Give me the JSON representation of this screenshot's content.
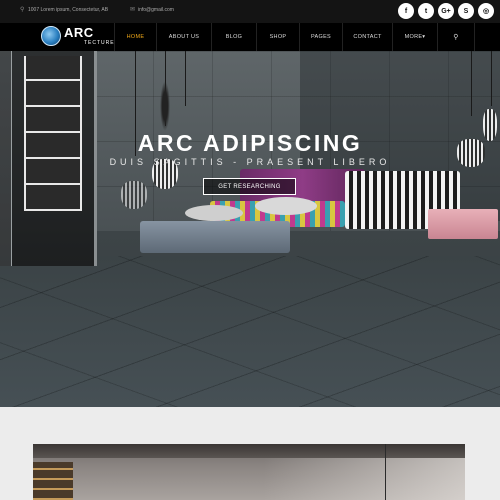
{
  "topbar": {
    "address": "1007 Lorem ipsum, Consectetur, AB",
    "email": "info@gmail.com",
    "social": [
      {
        "icon": "facebook-icon",
        "glyph": "f"
      },
      {
        "icon": "twitter-icon",
        "glyph": "t"
      },
      {
        "icon": "google-plus-icon",
        "glyph": "G+"
      },
      {
        "icon": "skype-icon",
        "glyph": "S"
      },
      {
        "icon": "instagram-icon",
        "glyph": "◎"
      }
    ]
  },
  "logo": {
    "main": "ARC",
    "sub": "TECTURE"
  },
  "nav": {
    "items": [
      {
        "label": "HOME",
        "active": true
      },
      {
        "label": "ABOUT US",
        "active": false
      },
      {
        "label": "BLOG",
        "active": false
      },
      {
        "label": "SHOP",
        "active": false
      },
      {
        "label": "PAGES",
        "active": false
      },
      {
        "label": "CONTACT",
        "active": false
      },
      {
        "label": "MORE▾",
        "active": false
      }
    ],
    "search_glyph": "⚲",
    "active_color": "#f0a818"
  },
  "hero": {
    "title": "ARC ADIPISCING",
    "subtitle": "DUIS SAGITTIS - PRAESENT LIBERO",
    "button": "GET RESEARCHING"
  }
}
